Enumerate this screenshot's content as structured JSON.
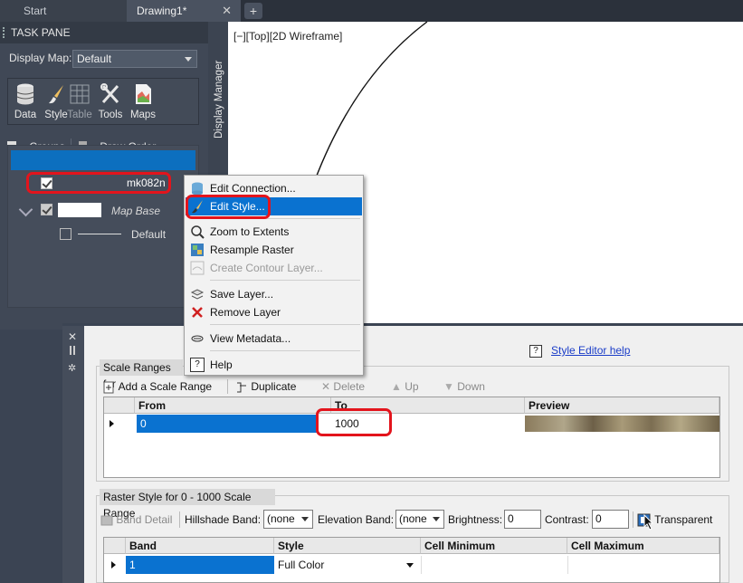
{
  "tabs": {
    "start": "Start",
    "drawing": "Drawing1*",
    "close": "✕",
    "add": "+"
  },
  "taskpane": {
    "title": "TASK PANE",
    "display_map_label": "Display Map:",
    "display_map_value": "Default",
    "side_label": "Display Manager",
    "tools": {
      "data": "Data",
      "style": "Style",
      "table": "Table",
      "tools": "Tools",
      "maps": "Maps"
    },
    "groups": "Groups",
    "draw_order": "Draw Order",
    "layers": [
      {
        "name": "mk082n",
        "checked": true,
        "selected": true
      },
      {
        "name": "Map Base",
        "checked": true
      },
      {
        "name": "Default",
        "checked": false
      }
    ]
  },
  "viewport_label": "[−][Top][2D Wireframe]",
  "context_menu": {
    "items": [
      {
        "label": "Edit Connection...",
        "icon": "connection-icon"
      },
      {
        "label": "Edit Style...",
        "icon": "paintbrush-icon",
        "active": true
      },
      {
        "label": "Zoom to Extents",
        "icon": "zoom-extents-icon"
      },
      {
        "label": "Resample Raster",
        "icon": "raster-icon"
      },
      {
        "label": "Create Contour Layer...",
        "icon": "contour-icon",
        "disabled": true
      },
      {
        "label": "Save Layer...",
        "icon": "save-layer-icon"
      },
      {
        "label": "Remove Layer",
        "icon": "remove-icon"
      },
      {
        "label": "View Metadata...",
        "icon": "metadata-icon"
      },
      {
        "label": "Help",
        "icon": "help-icon"
      }
    ]
  },
  "style_editor": {
    "help_link": "Style Editor help",
    "scale_ranges_header": "Scale Ranges for",
    "toolbar": {
      "add_scale_range": "Add a Scale Range",
      "duplicate": "Duplicate",
      "delete": "Delete",
      "up": "Up",
      "down": "Down"
    },
    "scale_table": {
      "columns": [
        "From",
        "To",
        "Preview"
      ],
      "rows": [
        {
          "from": "0",
          "to": "1000"
        }
      ]
    },
    "raster_style_header": "Raster Style for 0 - 1000 Scale Range",
    "band_detail": "Band Detail",
    "hillshade_label": "Hillshade Band:",
    "hillshade_value": "(none",
    "elevation_label": "Elevation Band:",
    "elevation_value": "(none",
    "brightness_label": "Brightness:",
    "brightness_value": "0",
    "contrast_label": "Contrast:",
    "contrast_value": "0",
    "transparent_label": "Transparent",
    "band_table": {
      "columns": [
        "Band",
        "Style",
        "Cell Minimum",
        "Cell Maximum"
      ],
      "rows": [
        {
          "band": "1",
          "style": "Full Color"
        }
      ]
    }
  },
  "colors": {
    "selection": "#0c6fbf",
    "highlight_red": "#e3141c",
    "menu_active": "#0a72d0"
  }
}
